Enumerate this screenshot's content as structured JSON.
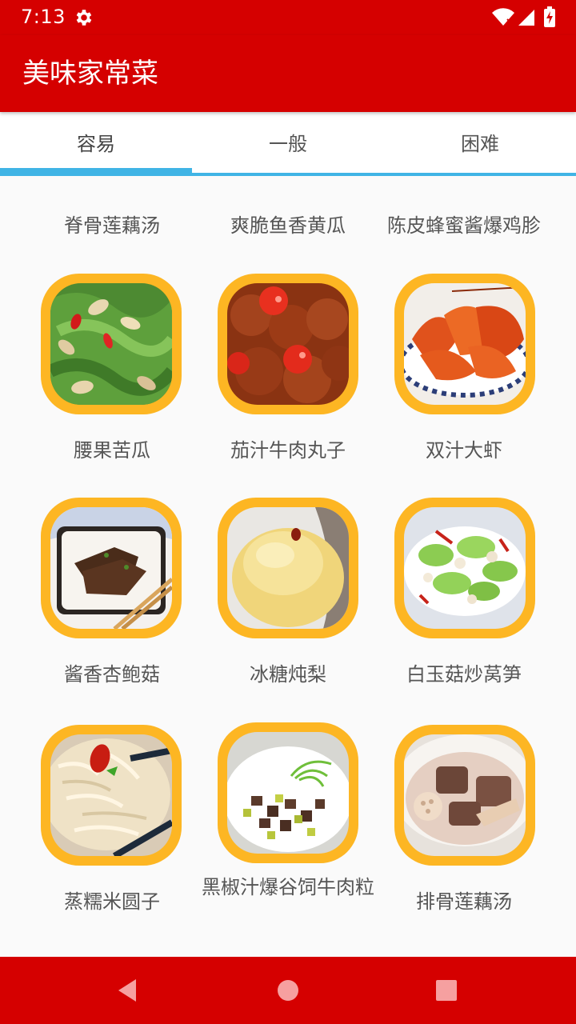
{
  "status_bar": {
    "time": "7:13"
  },
  "app_bar": {
    "title": "美味家常菜"
  },
  "tabs": [
    {
      "label": "容易",
      "selected": true
    },
    {
      "label": "一般",
      "selected": false
    },
    {
      "label": "困难",
      "selected": false
    }
  ],
  "top_row_labels": [
    "脊骨莲藕汤",
    "爽脆鱼香黄瓜",
    "陈皮蜂蜜酱爆鸡胗"
  ],
  "dishes": [
    {
      "name": "腰果苦瓜",
      "icon": "bitter-melon-cashew-photo"
    },
    {
      "name": "茄汁牛肉丸子",
      "icon": "tomato-beef-balls-photo"
    },
    {
      "name": "双汁大虾",
      "icon": "shrimp-photo"
    },
    {
      "name": "酱香杏鲍菇",
      "icon": "king-oyster-mushroom-photo"
    },
    {
      "name": "冰糖炖梨",
      "icon": "stewed-pear-photo"
    },
    {
      "name": "白玉菇炒莴笋",
      "icon": "mushroom-lettuce-photo"
    },
    {
      "name": "蒸糯米圆子",
      "icon": "sticky-rice-balls-photo"
    },
    {
      "name": "黑椒汁爆谷饲牛肉粒",
      "icon": "black-pepper-beef-photo"
    },
    {
      "name": "排骨莲藕汤",
      "icon": "rib-lotus-soup-photo"
    }
  ],
  "colors": {
    "primary": "#d50000",
    "tab_indicator": "#40b4e5",
    "card_frame": "#fdb623",
    "text": "#555555"
  }
}
